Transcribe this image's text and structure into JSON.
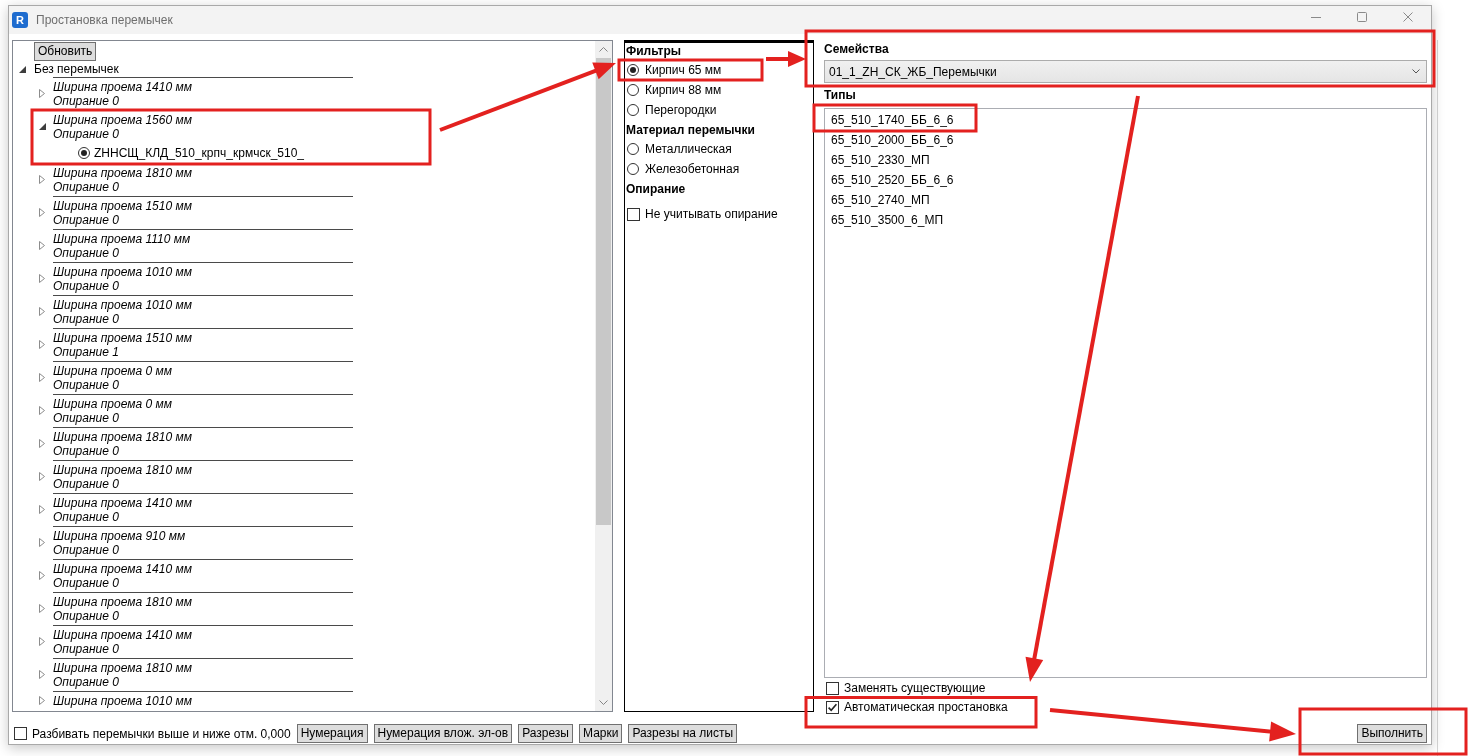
{
  "window": {
    "icon_text": "R",
    "title": "Простановка перемычек"
  },
  "tree": {
    "refresh_button": "Обновить",
    "root": {
      "label": "Без перемычек",
      "expanded": true,
      "children": [
        {
          "title": "Ширина проема 1410 мм",
          "support": "Опирание 0",
          "expanded": false
        },
        {
          "title": "Ширина проема 1560 мм",
          "support": "Опирание 0",
          "expanded": true,
          "children": [
            {
              "label": "ZHHСЩ_КЛД_510_крпч_крмчск_510_",
              "selected": true
            }
          ]
        },
        {
          "title": "Ширина проема 1810 мм",
          "support": "Опирание 0",
          "expanded": false
        },
        {
          "title": "Ширина проема 1510 мм",
          "support": "Опирание 0",
          "expanded": false
        },
        {
          "title": "Ширина проема 1110 мм",
          "support": "Опирание 0",
          "expanded": false
        },
        {
          "title": "Ширина проема 1010 мм",
          "support": "Опирание 0",
          "expanded": false
        },
        {
          "title": "Ширина проема 1010 мм",
          "support": "Опирание 0",
          "expanded": false
        },
        {
          "title": "Ширина проема 1510 мм",
          "support": "Опирание 1",
          "expanded": false
        },
        {
          "title": "Ширина проема 0 мм",
          "support": "Опирание 0",
          "expanded": false
        },
        {
          "title": "Ширина проема 0 мм",
          "support": "Опирание 0",
          "expanded": false
        },
        {
          "title": "Ширина проема 1810 мм",
          "support": "Опирание 0",
          "expanded": false
        },
        {
          "title": "Ширина проема 1810 мм",
          "support": "Опирание 0",
          "expanded": false
        },
        {
          "title": "Ширина проема 1410 мм",
          "support": "Опирание 0",
          "expanded": false
        },
        {
          "title": "Ширина проема 910 мм",
          "support": "Опирание 0",
          "expanded": false
        },
        {
          "title": "Ширина проема 1410 мм",
          "support": "Опирание 0",
          "expanded": false
        },
        {
          "title": "Ширина проема 1810 мм",
          "support": "Опирание 0",
          "expanded": false
        },
        {
          "title": "Ширина проема 1410 мм",
          "support": "Опирание 0",
          "expanded": false
        },
        {
          "title": "Ширина проема 1810 мм",
          "support": "Опирание 0",
          "expanded": false
        },
        {
          "title": "Ширина проема 1010 мм",
          "expanded": false
        }
      ]
    }
  },
  "filters": [
    {
      "title": "Фильтры",
      "options": [
        {
          "kind": "radio",
          "label": "Кирпич 65 мм",
          "selected": true
        },
        {
          "kind": "radio",
          "label": "Кирпич 88 мм",
          "selected": false
        },
        {
          "kind": "radio",
          "label": "Перегородки",
          "selected": false
        }
      ]
    },
    {
      "title": "Материал перемычки",
      "options": [
        {
          "kind": "radio",
          "label": "Металлическая",
          "selected": false
        },
        {
          "kind": "radio",
          "label": "Железобетонная",
          "selected": false
        }
      ]
    },
    {
      "title": "Опирание",
      "options": [
        {
          "kind": "checkbox",
          "label": "Не учитывать опирание",
          "checked": false
        }
      ]
    }
  ],
  "families": {
    "label": "Семейства",
    "value": "01_1_ZH_СК_ЖБ_Перемычки"
  },
  "types": {
    "label": "Типы",
    "items": [
      {
        "label": "65_510_1740_ББ_6_6",
        "selected": false
      },
      {
        "label": "65_510_2000_ББ_6_6",
        "selected": false
      },
      {
        "label": "65_510_2330_МП",
        "selected": false
      },
      {
        "label": "65_510_2520_ББ_6_6",
        "selected": false
      },
      {
        "label": "65_510_2740_МП",
        "selected": false
      },
      {
        "label": "65_510_3500_6_МП",
        "selected": false
      }
    ]
  },
  "options": [
    {
      "label": "Заменять существующие",
      "checked": false
    },
    {
      "label": "Автоматическая простановка",
      "checked": true
    }
  ],
  "run_button": "Выполнить",
  "bottom_bar": {
    "split_option": {
      "label": "Разбивать перемычки выше и ниже отм. 0,000",
      "checked": false
    },
    "buttons": [
      "Нумерация",
      "Нумерация влож. эл-ов",
      "Разрезы",
      "Марки",
      "Разрезы на листы"
    ]
  }
}
